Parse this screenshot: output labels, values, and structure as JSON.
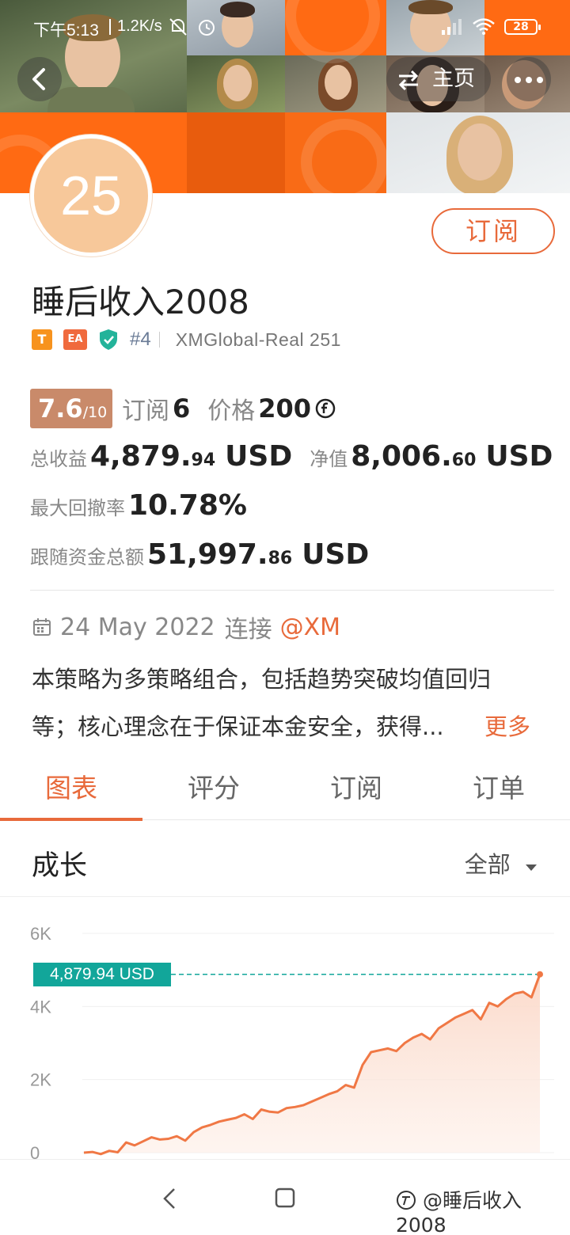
{
  "status_bar": {
    "time": "下午5:13",
    "net_speed": "1.2K/s",
    "battery": "28",
    "icons": [
      "mute-bell-icon",
      "alarm-icon",
      "signal-icon",
      "wifi-icon",
      "battery-icon"
    ]
  },
  "header": {
    "back_icon": "back-arrow-icon",
    "home_label": "主页",
    "home_icon": "swap-icon",
    "more_icon": "more-dots-icon"
  },
  "profile": {
    "avatar_text": "25",
    "subscribe_label": "订阅",
    "name": "睡后收入2008",
    "tag_t": "T",
    "tag_ea": "EA",
    "rank": "#4",
    "broker": "XMGlobal-Real 251"
  },
  "stats": {
    "score_main": "7.6",
    "score_den": "/10",
    "subs_label": "订阅",
    "subs_value": "6",
    "price_label": "价格",
    "price_value": "200",
    "total_profit_label": "总收益",
    "total_profit_int": "4,879.",
    "total_profit_dec": "94",
    "total_profit_unit": "USD",
    "equity_label": "净值",
    "equity_int": "8,006.",
    "equity_dec": "60",
    "equity_unit": "USD",
    "drawdown_label": "最大回撤率",
    "drawdown_value": "10.78%",
    "follow_label": "跟随资金总额",
    "follow_int": "51,997.",
    "follow_dec": "86",
    "follow_unit": "USD"
  },
  "connection": {
    "date": "24 May 2022",
    "connect_label": "连接",
    "broker_link": "@XM"
  },
  "description": {
    "line1": "本策略为多策略组合，包括趋势突破均值回归",
    "line2": "等；核心理念在于保证本金安全，获得...",
    "more": "更多"
  },
  "tabs": [
    "图表",
    "评分",
    "订阅",
    "订单"
  ],
  "growth": {
    "title": "成长",
    "selector": "全部"
  },
  "chart_data": {
    "type": "area",
    "title": "",
    "ylabel": "",
    "yticks": [
      "0",
      "2K",
      "4K",
      "6K"
    ],
    "ylim": [
      0,
      6000
    ],
    "current_label": "4,879.94 USD",
    "current_value": 4879.94,
    "series": [
      {
        "values": [
          0,
          20,
          -40,
          50,
          10,
          280,
          200,
          310,
          420,
          360,
          380,
          450,
          330,
          560,
          690,
          760,
          850,
          900,
          950,
          1050,
          920,
          1180,
          1120,
          1100,
          1220,
          1250,
          1300,
          1400,
          1500,
          1600,
          1680,
          1850,
          1780,
          2400,
          2750,
          2800,
          2850,
          2780,
          3000,
          3150,
          3250,
          3100,
          3400,
          3550,
          3700,
          3800,
          3900,
          3650,
          4100,
          4000,
          4200,
          4350,
          4400,
          4250,
          4879.94
        ]
      }
    ],
    "colors": {
      "line": "#f07845",
      "fill": "#fbd8c8",
      "label_bg": "#12a69a"
    },
    "grid": true
  },
  "navbar": {
    "back_icon": "nav-back-icon",
    "home_icon": "nav-home-icon"
  },
  "watermark": "@睡后收入2008"
}
